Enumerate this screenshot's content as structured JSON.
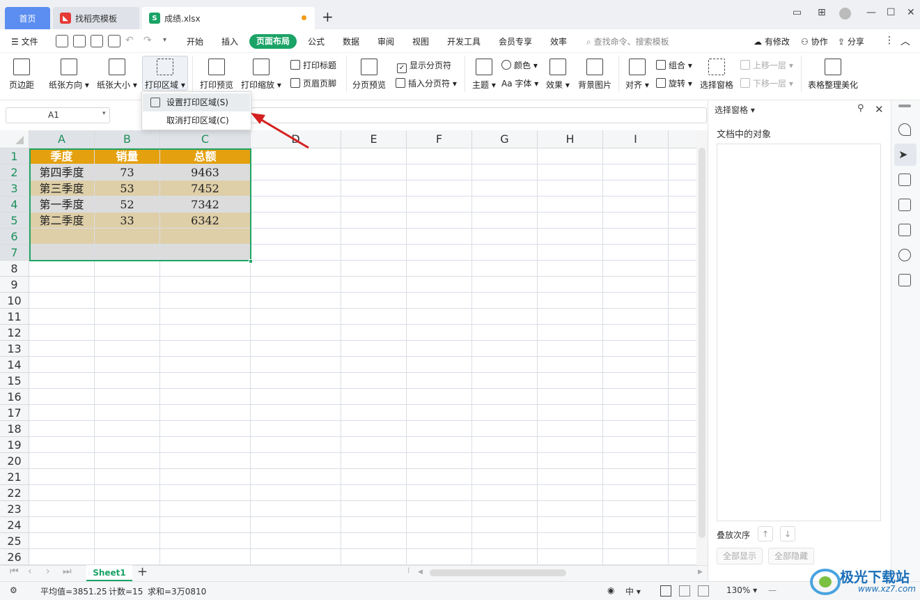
{
  "tabs": {
    "home": "首页",
    "daoke": "找稻壳模板",
    "file": "成绩.xlsx"
  },
  "menu": {
    "file": "文件",
    "items": [
      "开始",
      "插入",
      "页面布局",
      "公式",
      "数据",
      "审阅",
      "视图",
      "开发工具",
      "会员专享",
      "效率"
    ],
    "active": "页面布局",
    "search": "查找命令、搜索模板",
    "modified": "有修改",
    "collab": "协作",
    "share": "分享"
  },
  "ribbon": {
    "margins": "页边距",
    "orientation": "纸张方向",
    "size": "纸张大小",
    "print_area": "打印区域",
    "print_preview": "打印预览",
    "print_scale": "打印缩放",
    "print_titles": "打印标题",
    "header_footer": "页眉页脚",
    "page_break_preview": "分页预览",
    "show_breaks": "显示分页符",
    "insert_break": "插入分页符",
    "theme": "主题",
    "colors": "颜色",
    "fonts": "字体",
    "effects": "效果",
    "background": "背景图片",
    "align": "对齐",
    "group": "组合",
    "rotate": "旋转",
    "selection_pane": "选择窗格",
    "bring_forward": "上移一层",
    "send_backward": "下移一层",
    "beautify": "表格整理美化"
  },
  "dropdown": {
    "set": "设置打印区域(S)",
    "cancel": "取消打印区域(C)"
  },
  "namebox": "A1",
  "columns": [
    "A",
    "B",
    "C",
    "D",
    "E",
    "F",
    "G",
    "H",
    "I"
  ],
  "rows": [
    "1",
    "2",
    "3",
    "4",
    "5",
    "6",
    "7",
    "8",
    "9",
    "10",
    "11",
    "12",
    "13",
    "14",
    "15",
    "16",
    "17",
    "18",
    "19",
    "20",
    "21",
    "22",
    "23",
    "24",
    "25",
    "26"
  ],
  "table": {
    "header": [
      "季度",
      "销量",
      "总额"
    ],
    "rows": [
      [
        "第四季度",
        "73",
        "9463"
      ],
      [
        "第三季度",
        "53",
        "7452"
      ],
      [
        "第一季度",
        "52",
        "7342"
      ],
      [
        "第二季度",
        "33",
        "6342"
      ]
    ]
  },
  "panel": {
    "title": "选择窗格",
    "objects": "文档中的对象",
    "order": "叠放次序",
    "show_all": "全部显示",
    "hide_all": "全部隐藏"
  },
  "sheet_tab": "Sheet1",
  "status": {
    "average": "平均值=3851.25",
    "count": "计数=15",
    "sum": "求和=3万0810",
    "zoom": "130%"
  },
  "watermark": {
    "text": "极光下载站",
    "url": "www.xz7.com"
  },
  "colors": {
    "accent": "#1aa366",
    "header_fill": "#e4a00f",
    "band_gray": "#dcdcdc",
    "band_tan": "#dfcfa8",
    "arrow": "#d42020"
  }
}
